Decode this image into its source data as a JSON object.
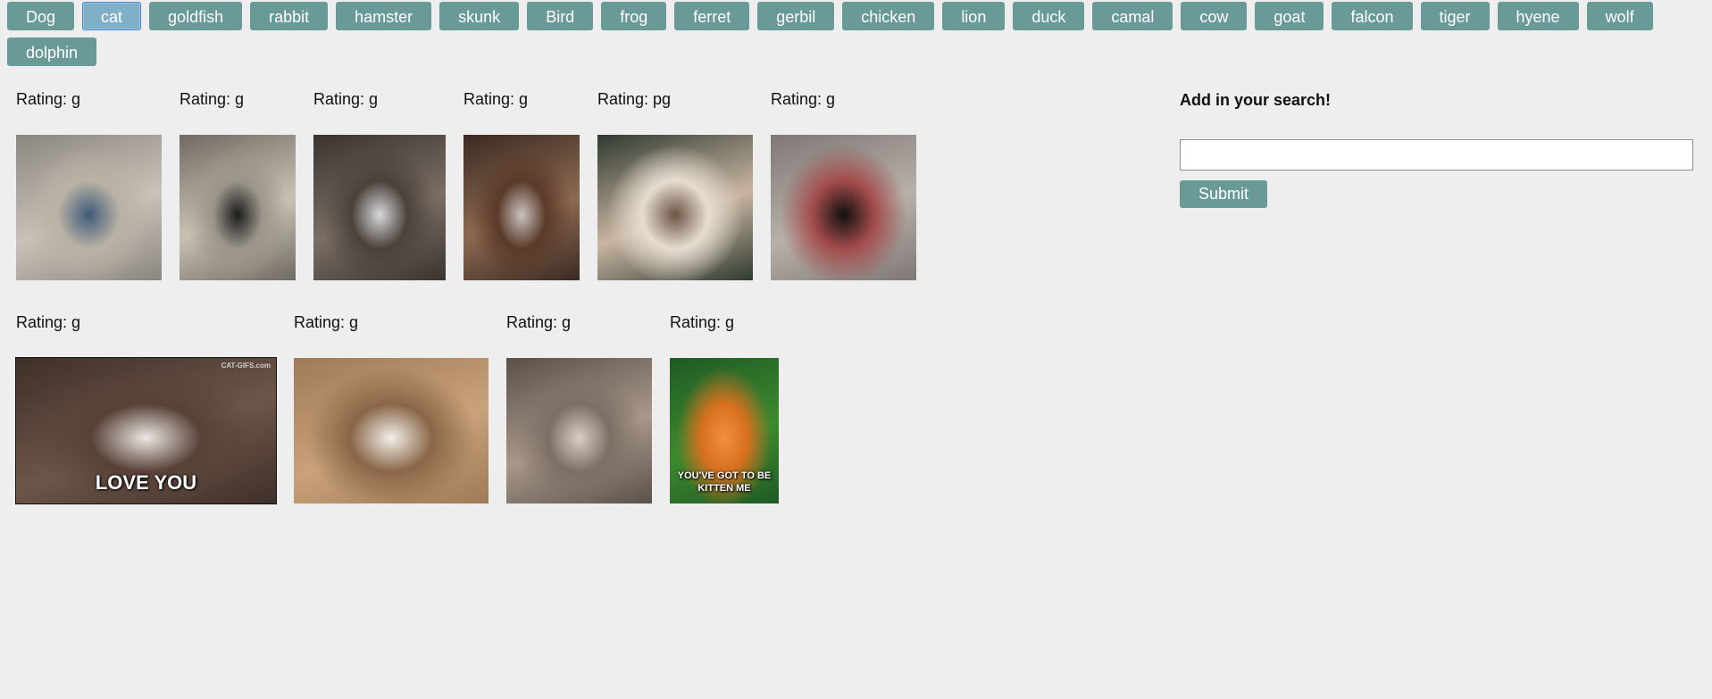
{
  "animals": [
    "Dog",
    "cat",
    "goldfish",
    "rabbit",
    "hamster",
    "skunk",
    "Bird",
    "frog",
    "ferret",
    "gerbil",
    "chicken",
    "lion",
    "duck",
    "camal",
    "cow",
    "goat",
    "falcon",
    "tiger",
    "hyene",
    "wolf",
    "dolphin"
  ],
  "active_animal": "cat",
  "rating_prefix": "Rating: ",
  "gif_rows": [
    [
      {
        "rating": "g",
        "alt": "cat gif",
        "caption": "",
        "colors": [
          "#8a8680",
          "#c9c2b8",
          "#b8b1a4",
          "#3f5a7a"
        ]
      },
      {
        "rating": "g",
        "alt": "cat gif",
        "caption": "",
        "colors": [
          "#6f6a62",
          "#c9c2b4",
          "#9a958a",
          "#1c1c1c"
        ]
      },
      {
        "rating": "g",
        "alt": "cat gif",
        "caption": "",
        "colors": [
          "#3a332e",
          "#7a6f66",
          "#4b423b",
          "#d8d8dc"
        ]
      },
      {
        "rating": "g",
        "alt": "cat gif",
        "caption": "",
        "colors": [
          "#3b2a22",
          "#8c6a52",
          "#5a3a28",
          "#c8c2c0"
        ]
      },
      {
        "rating": "pg",
        "alt": "cat gif",
        "caption": "",
        "colors": [
          "#2f3a30",
          "#c8b4a0",
          "#e6ddd0",
          "#6b5444"
        ]
      },
      {
        "rating": "g",
        "alt": "cat gif",
        "caption": "",
        "colors": [
          "#7e7874",
          "#b8b0aa",
          "#a24a4a",
          "#111111"
        ]
      }
    ],
    [
      {
        "rating": "g",
        "alt": "cat gif",
        "caption": "LOVE YOU",
        "watermark": "CAT-GIFS.com",
        "colors": [
          "#3e3029",
          "#6d5548",
          "#584238",
          "#ece8e4"
        ]
      },
      {
        "rating": "g",
        "alt": "cat gif",
        "caption": "",
        "colors": [
          "#a07a58",
          "#c9a27a",
          "#8a6648",
          "#f2efea"
        ]
      },
      {
        "rating": "g",
        "alt": "cat gif",
        "caption": "",
        "colors": [
          "#5a5048",
          "#a8978a",
          "#7d6f64",
          "#d9cfc4"
        ]
      },
      {
        "rating": "g",
        "alt": "cat gif",
        "caption": "YOU'VE GOT TO BE KITTEN ME",
        "colors": [
          "#1e5a24",
          "#3d8a2e",
          "#d8701e",
          "#f09040"
        ]
      }
    ]
  ],
  "search": {
    "heading": "Add in your search!",
    "input_value": "",
    "placeholder": "",
    "submit_label": "Submit"
  }
}
